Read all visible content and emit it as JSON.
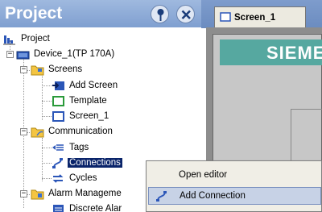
{
  "panel": {
    "title": "Project"
  },
  "tree": {
    "root": "Project",
    "device": "Device_1(TP 170A)",
    "screens": "Screens",
    "add_screen": "Add Screen",
    "template": "Template",
    "screen_1": "Screen_1",
    "communication": "Communication",
    "tags": "Tags",
    "connections": "Connections",
    "cycles": "Cycles",
    "alarm_management": "Alarm Manageme",
    "discrete_alarms": "Discrete Alar"
  },
  "editor": {
    "tab_label": "Screen_1",
    "brand_text": "SIEME"
  },
  "context_menu": {
    "items": [
      {
        "label": "Open editor"
      },
      {
        "label": "Add Connection"
      }
    ]
  },
  "colors": {
    "header_blue": "#8eaad8",
    "selection": "#0a246a",
    "brand_teal": "#56a8a0",
    "folder_yellow": "#f4c542"
  }
}
